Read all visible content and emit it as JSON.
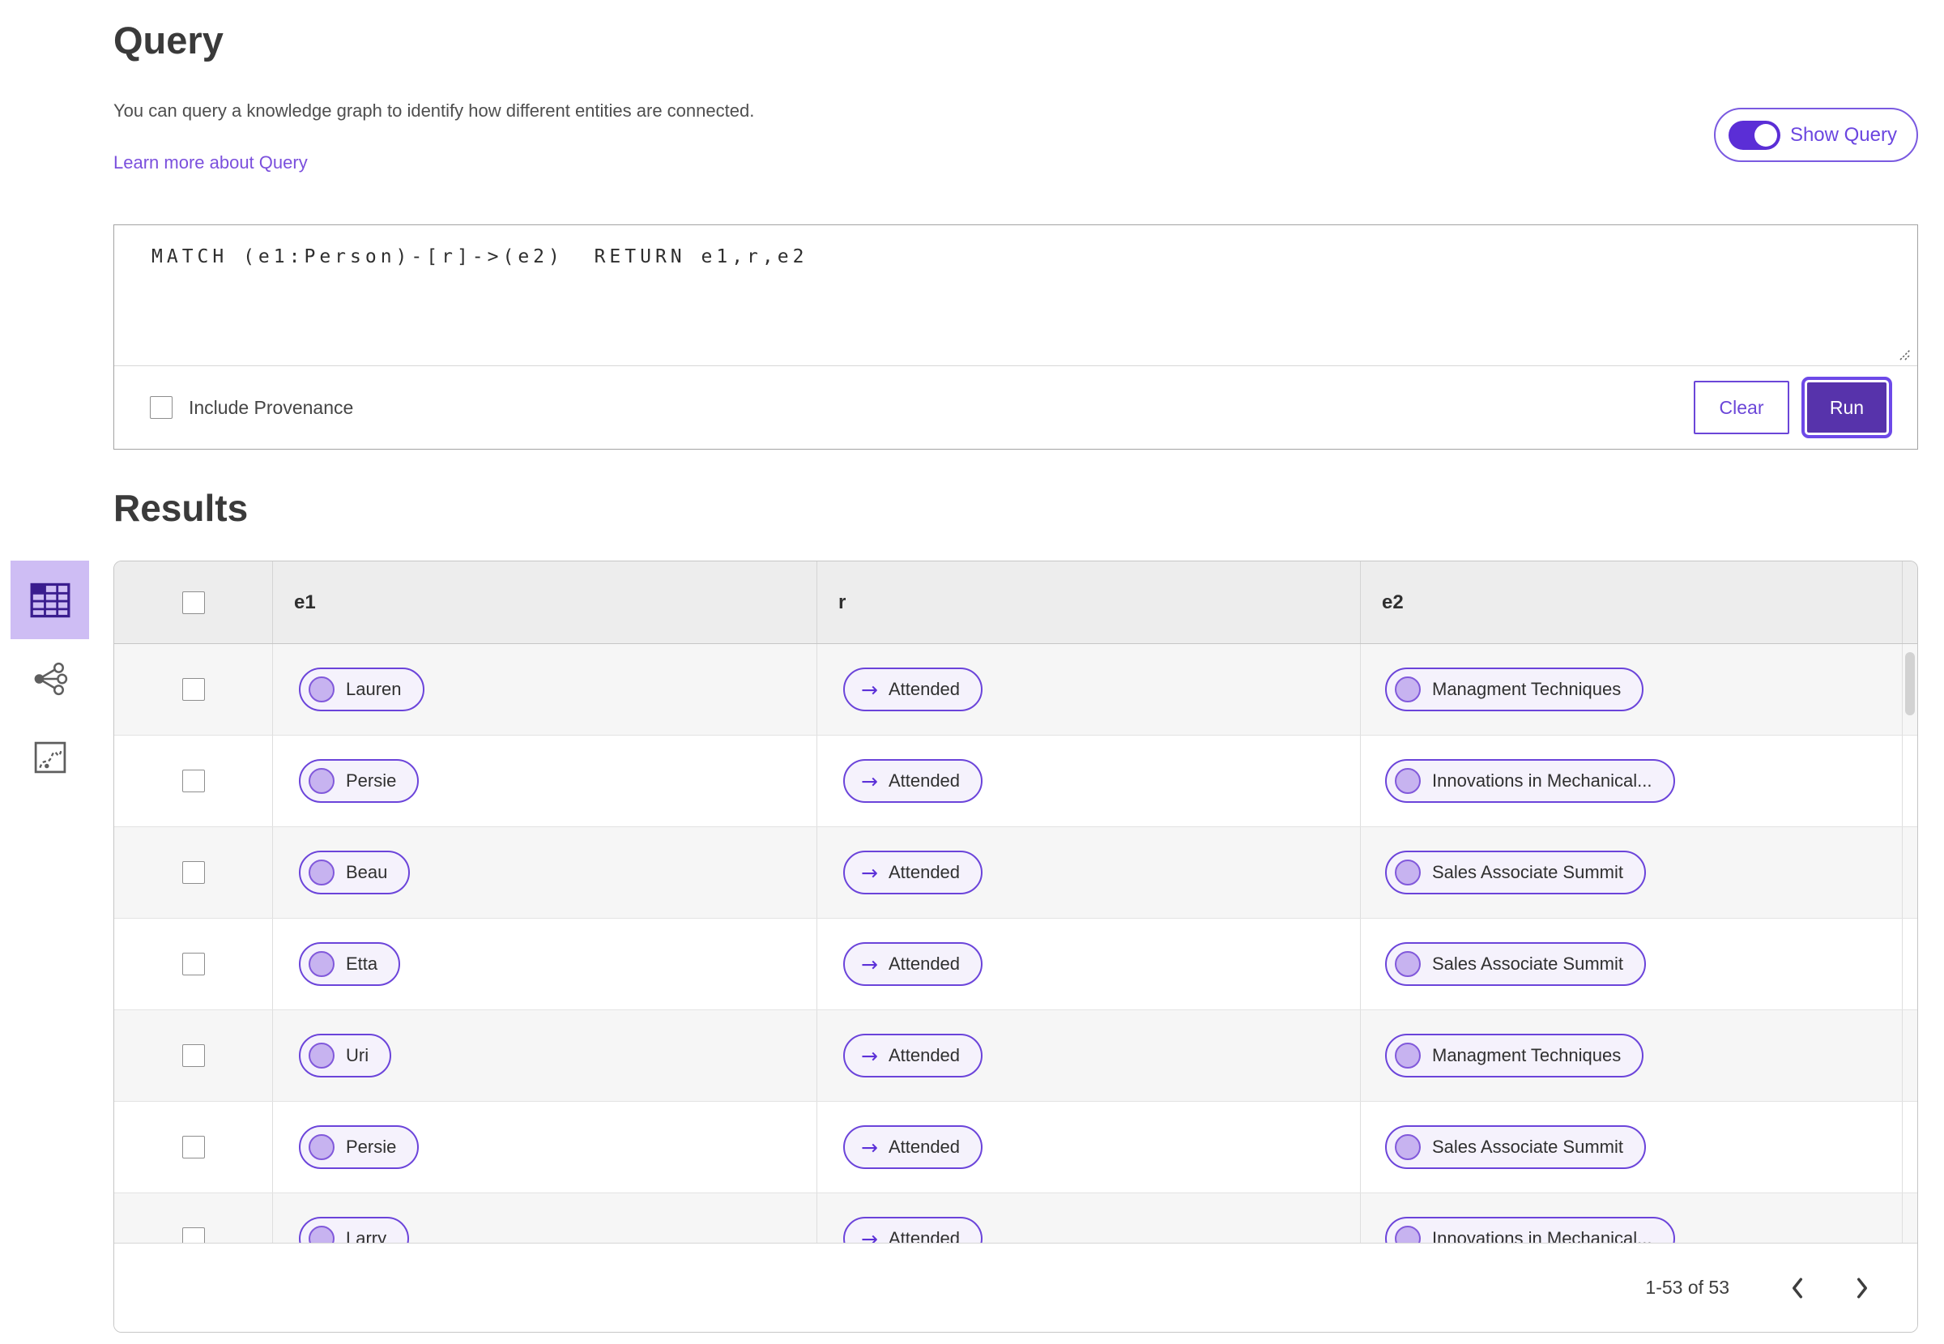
{
  "query_section": {
    "title": "Query",
    "description": "You can query a knowledge graph to identify how different entities are connected.",
    "learn_more_label": "Learn more about Query",
    "show_query": {
      "label": "Show Query",
      "state": "on"
    },
    "editor": {
      "query_text": "MATCH (e1:Person)-[r]->(e2)  RETURN e1,r,e2"
    },
    "include_provenance": {
      "label": "Include Provenance",
      "checked": false
    },
    "buttons": {
      "clear": "Clear",
      "run": "Run"
    }
  },
  "results_section": {
    "title": "Results",
    "view_rail": [
      {
        "name": "table-view",
        "selected": true
      },
      {
        "name": "network-view",
        "selected": false
      },
      {
        "name": "chart-view",
        "selected": false
      }
    ],
    "table": {
      "columns": [
        "e1",
        "r",
        "e2"
      ],
      "relation_arrow": "→",
      "rows": [
        {
          "e1": "Lauren",
          "r": "Attended",
          "e2": "Managment Techniques"
        },
        {
          "e1": "Persie",
          "r": "Attended",
          "e2": "Innovations in Mechanical..."
        },
        {
          "e1": "Beau",
          "r": "Attended",
          "e2": "Sales Associate Summit"
        },
        {
          "e1": "Etta",
          "r": "Attended",
          "e2": "Sales Associate Summit"
        },
        {
          "e1": "Uri",
          "r": "Attended",
          "e2": "Managment Techniques"
        },
        {
          "e1": "Persie",
          "r": "Attended",
          "e2": "Sales Associate Summit"
        },
        {
          "e1": "Larry",
          "r": "Attended",
          "e2": "Innovations in Mechanical..."
        }
      ]
    },
    "pagination": {
      "range_label": "1-53 of 53"
    }
  },
  "colors": {
    "accent_purple": "#5b2ed6",
    "run_fill": "#5733ab",
    "link": "#7b50dd",
    "pill_border": "#6b44da",
    "pill_bg": "#f5f2fc",
    "node_fill": "#c7b3f0",
    "node_border": "#8159db",
    "selected_tile_bg": "#cebdf4"
  }
}
